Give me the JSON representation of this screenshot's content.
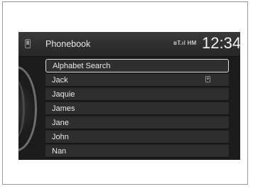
{
  "header": {
    "title": "Phonebook",
    "status_text": "ʙT.ıl HM",
    "clock": "12:34"
  },
  "list": {
    "items": [
      {
        "label": "Alphabet Search",
        "selected": true
      },
      {
        "label": "Jack",
        "has_icon": true
      },
      {
        "label": "Jaquie"
      },
      {
        "label": "James"
      },
      {
        "label": "Jane"
      },
      {
        "label": "John"
      },
      {
        "label": "Nan"
      }
    ]
  },
  "icons": {
    "phone": "phone-icon",
    "contact": "contact-card-icon"
  }
}
